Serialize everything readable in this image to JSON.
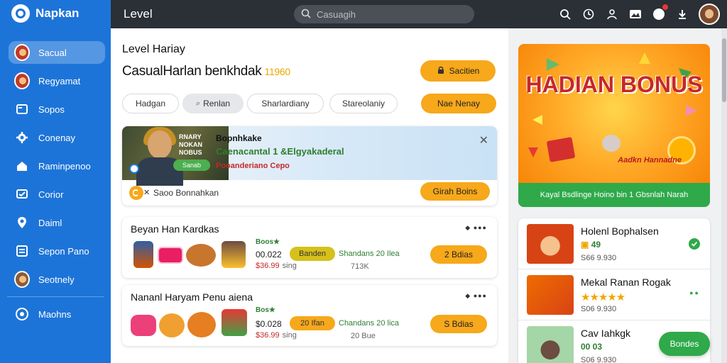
{
  "app": {
    "brand": "Napkan",
    "page_title": "Level"
  },
  "search": {
    "placeholder": "Casuagih"
  },
  "sidebar": {
    "items": [
      {
        "label": "Sacual",
        "icon": "user-avatar-icon",
        "active": true
      },
      {
        "label": "Regyamat",
        "icon": "user-avatar-icon"
      },
      {
        "label": "Sopos",
        "icon": "card-icon"
      },
      {
        "label": "Conenay",
        "icon": "gear-icon"
      },
      {
        "label": "Raminpenoo",
        "icon": "home-icon"
      },
      {
        "label": "Corior",
        "icon": "chat-icon"
      },
      {
        "label": "Daiml",
        "icon": "location-pin-icon"
      },
      {
        "label": "Sepon Pano",
        "icon": "list-icon"
      },
      {
        "label": "Seotnely",
        "icon": "user-avatar-icon"
      },
      {
        "label": "Maohns",
        "icon": "settings-circle-icon"
      }
    ]
  },
  "main": {
    "level_label": "Level Hariay",
    "headline": "CasualHarlan benkhdak",
    "headline_number": "11960",
    "top_button": "Sacitien",
    "tabs": [
      {
        "label": "Hadgan"
      },
      {
        "label": "Renlan",
        "active": true
      },
      {
        "label": "Sharlardiany"
      },
      {
        "label": "Stareolaniy"
      }
    ],
    "tab_cta": "Nae Nenay",
    "promo": {
      "photo_text": [
        "RNARY",
        "NOKAN",
        "NOBUS"
      ],
      "photo_button": "Sanab",
      "title": "Bopnhkake",
      "headline": "Caenacantal 1 &Elgyakaderal",
      "subline": "Pooanderiano Cepo",
      "note": "Saoo Bonnahkan",
      "cta": "Girah Boins"
    },
    "products": [
      {
        "title": "Beyan Han Kardkas",
        "stars": "Boos★",
        "price": "00.022",
        "price_sub": "$36.99",
        "unit": "sing",
        "pill": "Banden",
        "green": "Shandans 20 Ilea",
        "grey": "713K",
        "cta": "2 Bdias"
      },
      {
        "title": "Nananl Haryam Penu aiena",
        "stars": "Bos★",
        "price": "$0.028",
        "price_sub": "$36.99",
        "unit": "sing",
        "pill": "20 Ifan",
        "green": "Chandans 20 lica",
        "grey": "20 Bue",
        "cta": "S Bdias"
      }
    ]
  },
  "right": {
    "bonus": {
      "title": "HADIAN BONUS",
      "subtitle": "Aadkn Hannadne",
      "footer": "Kayal Bsdlinge Hoino bin 1 Gbsnlah Narah"
    },
    "list": [
      {
        "title": "Holenl Bophalsen",
        "rating": "49",
        "meta": "S66 9.930",
        "status": "check"
      },
      {
        "title": "Mekal Ranan Rogak",
        "stars": "★★★★★",
        "meta": "S06 9.930",
        "status": "dots"
      },
      {
        "title": "Cav Iahkgk",
        "rating": "00 03",
        "meta": "S06 9.930",
        "status": "none"
      }
    ],
    "fab": "Bondes"
  },
  "colors": {
    "sidebar": "#1d74d8",
    "topbar": "#2b2f36",
    "accent_orange": "#f7a81b",
    "accent_green": "#2fa94a"
  }
}
